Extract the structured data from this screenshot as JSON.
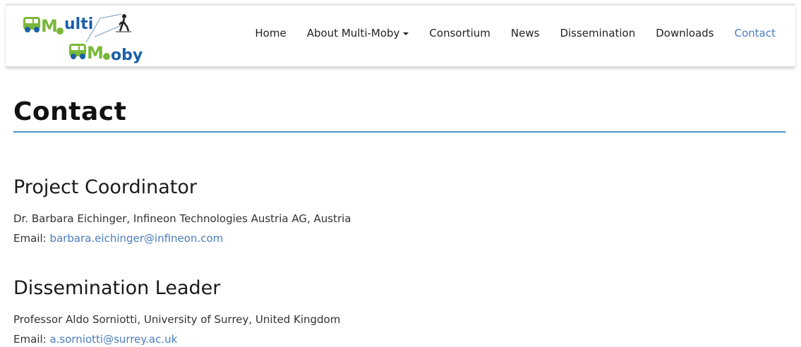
{
  "header": {
    "logo": {
      "text_top": "ulti",
      "text_bottom": "oby",
      "letter": "M",
      "icon": "pedestrian-crossing-icon",
      "colors": {
        "green": "#7ab83a",
        "blue": "#1d5fa8"
      }
    },
    "nav": {
      "items": [
        {
          "label": "Home"
        },
        {
          "label": "About Multi-Moby",
          "dropdown": true
        },
        {
          "label": "Consortium"
        },
        {
          "label": "News"
        },
        {
          "label": "Dissemination"
        },
        {
          "label": "Downloads"
        },
        {
          "label": "Contact",
          "active": true
        }
      ]
    }
  },
  "main": {
    "title": "Contact",
    "sections": [
      {
        "heading": "Project Coordinator",
        "person": "Dr. Barbara Eichinger, Infineon Technologies Austria AG, Austria",
        "email_label": "Email:",
        "email": "barbara.eichinger@infineon.com"
      },
      {
        "heading": "Dissemination Leader",
        "person": "Professor Aldo Sorniotti, University of Surrey, United Kingdom",
        "email_label": "Email:",
        "email": "a.sorniotti@surrey.ac.uk"
      }
    ]
  },
  "colors": {
    "accent": "#4a7cc0",
    "rule": "#4a8fc9",
    "text": "#333333"
  }
}
